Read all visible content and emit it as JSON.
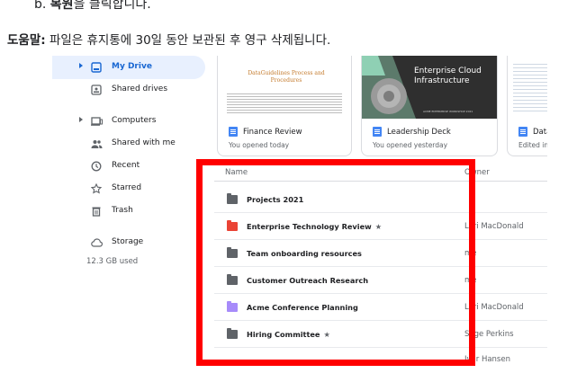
{
  "doc": {
    "step_prefix": "b. ",
    "step_bold": "복원",
    "step_rest": "을 클릭합니다.",
    "tip_label": "도움말:",
    "tip_text": " 파일은 휴지통에 30일 동안 보관된 후 영구 삭제됩니다."
  },
  "sidebar": {
    "items": [
      {
        "label": "My Drive",
        "icon": "drive-icon"
      },
      {
        "label": "Shared drives",
        "icon": "shared-drives-icon"
      },
      {
        "label": "Computers",
        "icon": "computer-icon"
      },
      {
        "label": "Shared with me",
        "icon": "people-icon"
      },
      {
        "label": "Recent",
        "icon": "clock-icon"
      },
      {
        "label": "Starred",
        "icon": "star-icon"
      },
      {
        "label": "Trash",
        "icon": "trash-icon"
      },
      {
        "label": "Storage",
        "icon": "cloud-icon"
      }
    ],
    "storage_used": "12.3 GB used"
  },
  "cards": [
    {
      "title": "Finance Review",
      "subtitle": "You opened today",
      "thumb_title": "DataGuidelines Process and Procedures"
    },
    {
      "title": "Leadership Deck",
      "subtitle": "You opened yesterday",
      "thumb_title": "Enterprise Cloud Infrastructure",
      "thumb_footer": "ACME ENTERPRISE WORKSHOP 2021"
    },
    {
      "title": "Data",
      "subtitle": "Edited in"
    }
  ],
  "list": {
    "col_name": "Name",
    "col_owner": "Owner",
    "rows": [
      {
        "name": "Projects 2021",
        "owner": "",
        "starred": false
      },
      {
        "name": "Enterprise Technology Review",
        "owner": "Lori MacDonald",
        "starred": true
      },
      {
        "name": "Team onboarding resources",
        "owner": "me",
        "starred": false
      },
      {
        "name": "Customer Outreach Research",
        "owner": "me",
        "starred": false
      },
      {
        "name": "Acme Conference Planning",
        "owner": "Lori MacDonald",
        "starred": false
      },
      {
        "name": "Hiring Committee",
        "owner": "Sage Perkins",
        "starred": true
      }
    ],
    "partial_owner": "Ivar Hansen"
  },
  "colors": {
    "accent": "#1967d2",
    "highlight": "#ff0000",
    "folder_red": "#ea4335",
    "folder_purple": "#a78bfa",
    "folder_dark": "#5f6368"
  }
}
